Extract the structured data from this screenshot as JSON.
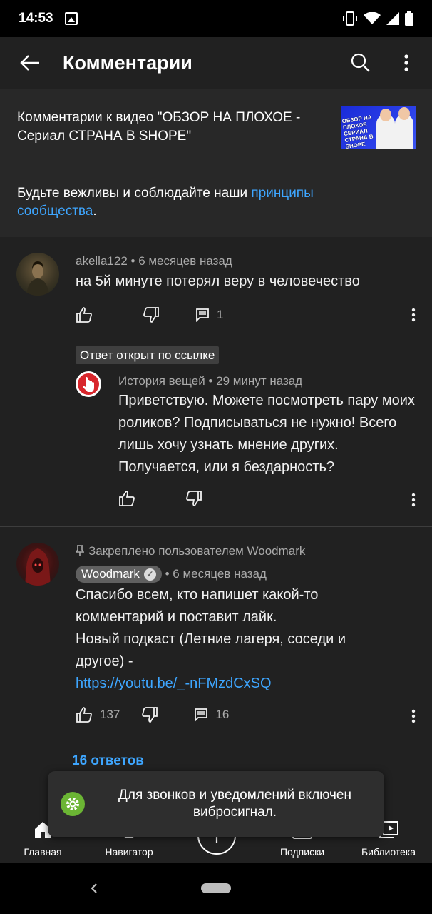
{
  "status_bar": {
    "time": "14:53"
  },
  "app_bar": {
    "title": "Комментарии"
  },
  "header": {
    "video_title": "Комментарии к видео \"ОБЗОР НА ПЛОХОЕ - Сериал СТРАНА В SHOPE\"",
    "thumb_text": "ОБЗОР НА ПЛОХОЕ СЕРИАЛ СТРАНА В SHOPE",
    "guidelines_prefix": "Будьте вежливы и соблюдайте наши ",
    "guidelines_link": "принципы сообщества",
    "guidelines_suffix": "."
  },
  "comments": [
    {
      "author": "akella122",
      "time": "6 месяцев назад",
      "text": "на 5й минуте потерял веру в человечество",
      "likes": "",
      "replies": "1"
    },
    {
      "badge": "Ответ открыт по ссылке",
      "author": "История вещей",
      "time": "29 минут назад",
      "text": "Приветствую. Можете посмотреть пару моих роликов? Подписываться не нужно! Всего лишь хочу узнать мнение других. Получается, или я бездарность?"
    },
    {
      "pinned": "Закреплено пользователем Woodmark",
      "author": "Woodmark",
      "time": "6 месяцев назад",
      "text_lines": [
        "Спасибо всем, кто напишет какой-то",
        "комментарий и поставит лайк.",
        "Новый подкаст (Летние лагеря, соседи и",
        "другое) -"
      ],
      "link": "https://youtu.be/_-nFMzdCxSQ",
      "likes": "137",
      "replies": "16",
      "replies_link": "16 ответов"
    }
  ],
  "bottom_nav": {
    "home": "Главная",
    "explore": "Навигатор",
    "subscriptions": "Подписки",
    "library": "Библиотека"
  },
  "toast": {
    "text": "Для звонков и уведомлений включен вибросигнал."
  },
  "colors": {
    "background": "#212121",
    "header": "#282828",
    "link": "#3ea6ff",
    "toast_icon": "#6bb534"
  }
}
